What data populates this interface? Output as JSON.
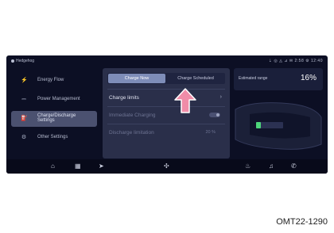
{
  "statusbar": {
    "left": "Hedgehog",
    "right": "⇣  ◎  ◬  ⊿  ✉  2:58  ⚙  12:40"
  },
  "sidebar": {
    "items": [
      {
        "icon": "charge-flow-icon",
        "glyph": "⚡",
        "label": "Energy Flow"
      },
      {
        "icon": "power-management-icon",
        "glyph": "⎓",
        "label": "Power Management"
      },
      {
        "icon": "charging-settings-icon",
        "glyph": "⛽",
        "label": "Charge/Discharge\nSettings",
        "active": true
      },
      {
        "icon": "other-settings-icon",
        "glyph": "⚙",
        "label": "Other Settings"
      }
    ]
  },
  "panel": {
    "tabs": [
      "Charge Now",
      "Charge Scheduled"
    ],
    "rows": [
      {
        "label": "Charge limits",
        "chevron": "›"
      },
      {
        "label": "Immediate Charging",
        "toggle": true,
        "dim": true
      },
      {
        "label": "Discharge limitation",
        "value": "20 %",
        "dim": true
      }
    ]
  },
  "rightcard": {
    "label": "Estimated range",
    "percent": "16%"
  },
  "bottombar": {
    "items": [
      {
        "name": "home-icon",
        "glyph": "⌂"
      },
      {
        "name": "apps-icon",
        "glyph": "▦"
      },
      {
        "name": "navigation-icon",
        "glyph": "➤"
      },
      {
        "name": "climate-icon",
        "glyph": "✣"
      },
      {
        "name": "seat-heat-icon",
        "glyph": "♨"
      },
      {
        "name": "music-icon",
        "glyph": "♫"
      },
      {
        "name": "phone-icon",
        "glyph": "✆"
      }
    ]
  },
  "caption": "OMT22-1290",
  "colors": {
    "accent": "#7e8db8",
    "arrow": "#f08ca8",
    "screen": "#0c0f24"
  }
}
